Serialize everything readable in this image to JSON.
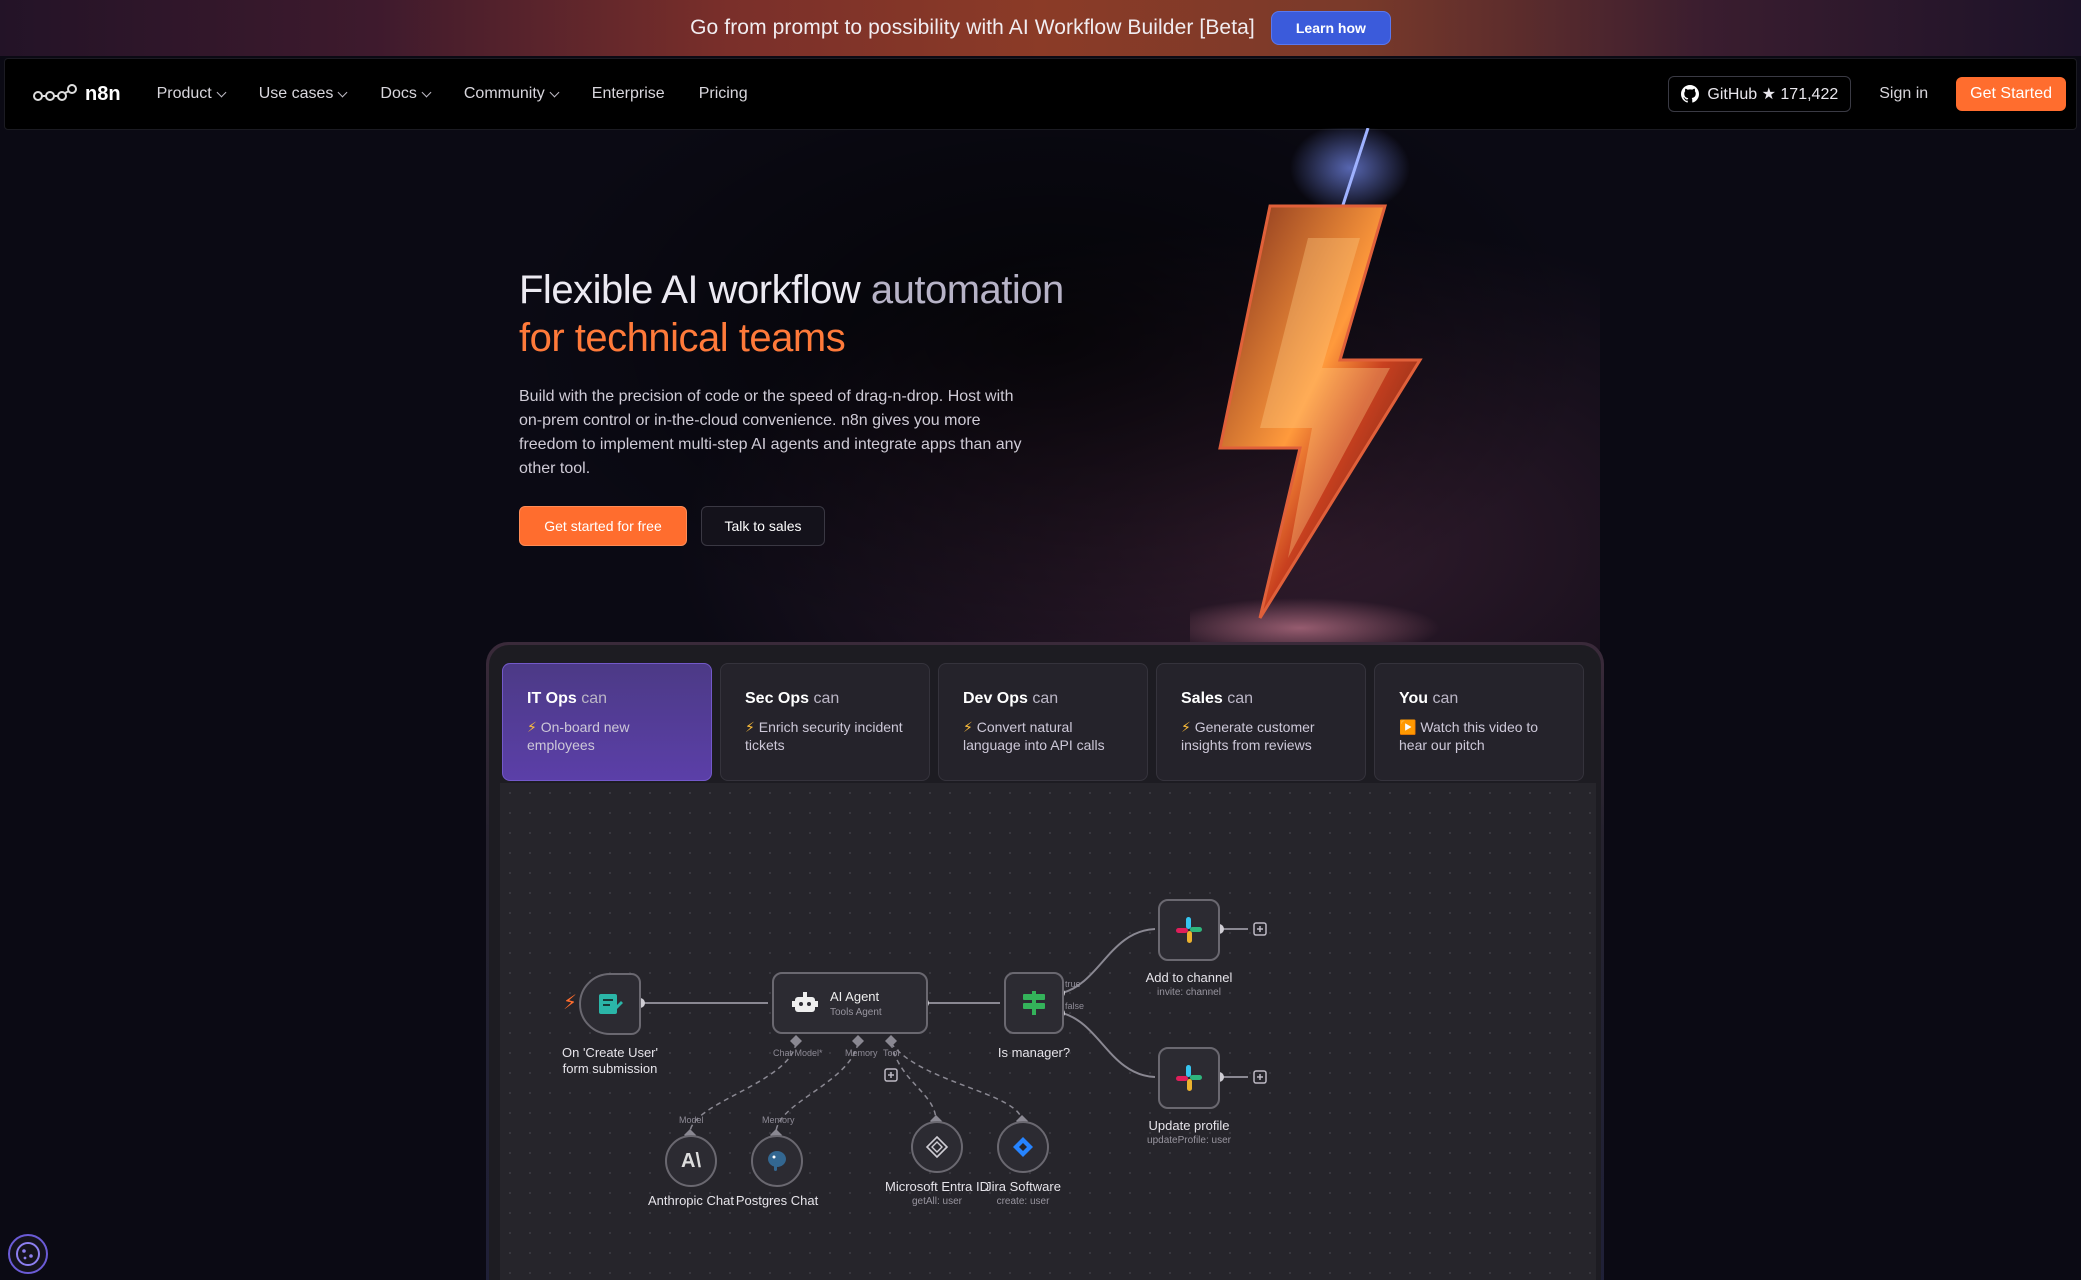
{
  "banner": {
    "text": "Go from prompt to possibility with AI Workflow Builder [Beta]",
    "button": "Learn how"
  },
  "nav": {
    "logo": "n8n",
    "links": [
      "Product",
      "Use cases",
      "Docs",
      "Community",
      "Enterprise",
      "Pricing"
    ],
    "github": "GitHub ★ 171,422",
    "signin": "Sign in",
    "get_started": "Get Started"
  },
  "hero": {
    "title_part1": "Flexible AI workflow ",
    "title_part1b": "automation",
    "title_part2": "for technical teams",
    "description": "Build with the precision of code or the speed of drag-n-drop. Host with on-prem control or in-the-cloud convenience. n8n gives you more freedom to implement multi-step AI agents and integrate apps than any other tool.",
    "primary_button": "Get started for free",
    "secondary_button": "Talk to sales"
  },
  "tabs": [
    {
      "who": "IT Ops",
      "can": "can",
      "icon": "⚡",
      "desc": "On-board new employees"
    },
    {
      "who": "Sec Ops",
      "can": "can",
      "icon": "⚡",
      "desc": "Enrich security incident tickets"
    },
    {
      "who": "Dev Ops",
      "can": "can",
      "icon": "⚡",
      "desc": "Convert natural language into API calls"
    },
    {
      "who": "Sales",
      "can": "can",
      "icon": "⚡",
      "desc": "Generate customer insights from reviews"
    },
    {
      "who": "You",
      "can": "can",
      "icon": "▶️",
      "desc": "Watch this video to hear our pitch"
    }
  ],
  "workflow": {
    "trigger": {
      "label": "On 'Create User' form submission"
    },
    "agent": {
      "label": "AI Agent",
      "sub": "Tools Agent",
      "ports": [
        "Chat Model*",
        "Memory",
        "Tool"
      ]
    },
    "if": {
      "label": "Is manager?",
      "true": "true",
      "false": "false"
    },
    "slack1": {
      "label": "Add to channel",
      "sub": "invite: channel"
    },
    "slack2": {
      "label": "Update profile",
      "sub": "updateProfile: user"
    },
    "anthropic": {
      "label": "Anthropic Chat",
      "port": "Model"
    },
    "postgres": {
      "label": "Postgres Chat",
      "port": "Memory"
    },
    "entra": {
      "label": "Microsoft Entra ID",
      "sub": "getAll: user"
    },
    "jira": {
      "label": "Jira Software",
      "sub": "create: user"
    }
  },
  "colors": {
    "accent": "#ff6d2e",
    "active_tab": "#5b3fa8",
    "banner_button": "#3b5bdb"
  }
}
